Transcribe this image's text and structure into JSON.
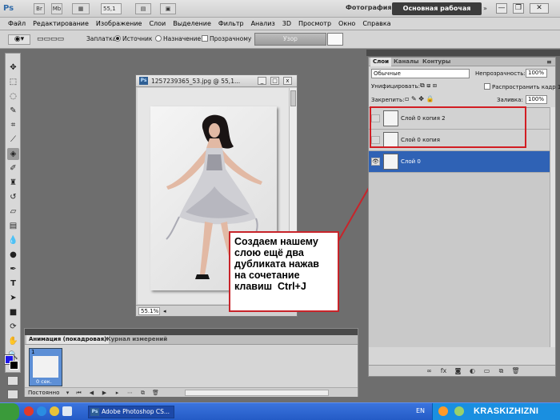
{
  "app": {
    "logo": "Ps",
    "zoom": "55,1",
    "workspace_photo": "Фотография",
    "workspace_main": "Основная рабочая среда",
    "workspace_more": "»",
    "win_minimize": "—",
    "win_restore": "❐",
    "win_close": "✕"
  },
  "menu": [
    "Файл",
    "Редактирование",
    "Изображение",
    "Слои",
    "Выделение",
    "Фильтр",
    "Анализ",
    "3D",
    "Просмотр",
    "Окно",
    "Справка"
  ],
  "options": {
    "patch_label": "Заплатка:",
    "source": "Источник",
    "destination": "Назначение",
    "transparent": "Прозрачному",
    "pattern_button": "Узор"
  },
  "document": {
    "title": "1257239365_53.jpg @ 55,1...",
    "zoom_status": "55.1%",
    "btn_min": "_",
    "btn_max": "□",
    "btn_close": "x"
  },
  "annotation": {
    "text_lines": [
      "Создаем нашему",
      "слою ещё два",
      "дубликата нажав",
      "на сочетание",
      "клавиш  Ctrl+J"
    ]
  },
  "layers_panel": {
    "tabs": [
      "Слои",
      "Каналы",
      "Контуры"
    ],
    "blend_mode": "Обычные",
    "opacity_label": "Непрозрачность:",
    "opacity_value": "100%",
    "unify_label": "Унифицировать:",
    "propagate_label": "Распространить кадр 1",
    "lock_label": "Закрепить:",
    "fill_label": "Заливка:",
    "fill_value": "100%",
    "layers": [
      {
        "name": "Слой 0 копия 2",
        "visible": false,
        "selected": false
      },
      {
        "name": "Слой 0 копия",
        "visible": false,
        "selected": false
      },
      {
        "name": "Слой 0",
        "visible": true,
        "selected": true
      }
    ]
  },
  "animation_panel": {
    "tabs": [
      "Анимация (покадровая)",
      "Журнал измерений"
    ],
    "frame_number": "1",
    "frame_delay": "0 сек.",
    "loop": "Постоянно"
  },
  "taskbar": {
    "task": "Adobe Photoshop CS...",
    "lang": "EN",
    "watermark": "KRASKIZHIZNI"
  },
  "colors": {
    "foreground": "#1f18e8",
    "background": "#000000",
    "selection": "#2f62b5",
    "annotation_border": "#c8242a"
  }
}
